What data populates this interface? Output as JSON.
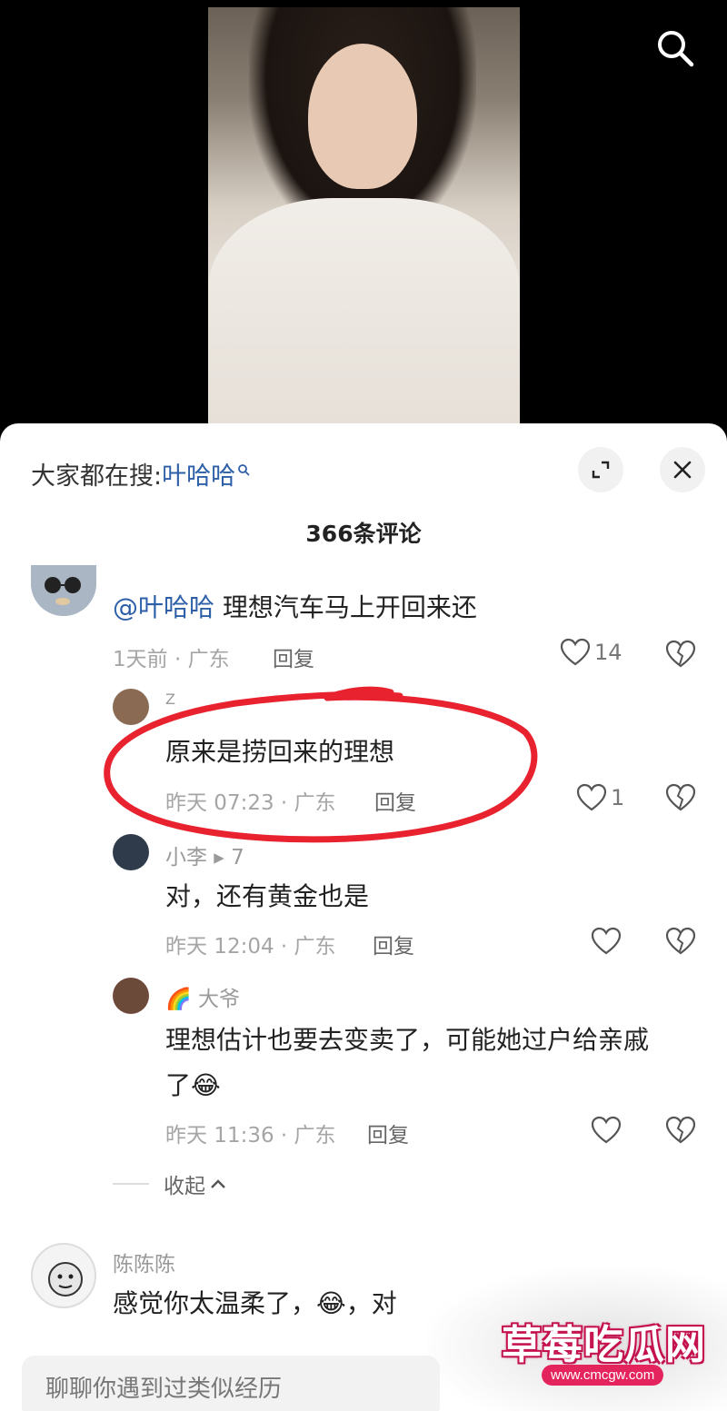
{
  "search_hint": {
    "prefix": "大家都在搜:",
    "keyword": "叶哈哈"
  },
  "comments_title": "366条评论",
  "comments": [
    {
      "mention": "@叶哈哈",
      "text": "理想汽车马上开回来还",
      "meta": "1天前 · 广东",
      "reply": "回复",
      "likes": "14"
    },
    {
      "name": "Z",
      "text": "原来是捞回来的理想",
      "meta": "昨天 07:23 · 广东",
      "reply": "回复",
      "likes": "1"
    },
    {
      "name": "小李 ▸ 7",
      "text": "对，还有黄金也是",
      "meta": "昨天 12:04 · 广东",
      "reply": "回复"
    },
    {
      "name": "大爷",
      "name_emoji": "🌈",
      "text_line1": "理想估计也要去变卖了，可能她过户给亲戚",
      "text_line2": "了😂",
      "meta": "昨天 11:36 · 广东",
      "reply": "回复"
    },
    {
      "name": "陈陈陈",
      "text": "感觉你太温柔了，😂，对"
    }
  ],
  "collapse_label": "收起",
  "input_placeholder": "聊聊你遇到过类似经历",
  "watermark": {
    "title": "草莓吃瓜网",
    "url": "www.cmcgw.com"
  },
  "colors": {
    "link": "#2d5fa8",
    "annotation_circle": "#e8232f",
    "watermark": "#e4245d"
  }
}
